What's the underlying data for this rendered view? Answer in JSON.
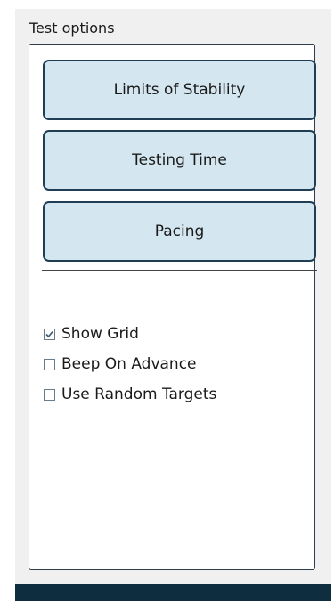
{
  "panel": {
    "title": "Test options"
  },
  "buttons": {
    "limits_of_stability": "Limits of Stability",
    "testing_time": "Testing Time",
    "pacing": "Pacing"
  },
  "options": {
    "show_grid": {
      "label": "Show Grid",
      "checked": true
    },
    "beep_on_advance": {
      "label": "Beep On Advance",
      "checked": false
    },
    "use_random_targets": {
      "label": "Use Random Targets",
      "checked": false
    }
  },
  "colors": {
    "button_fill": "#d4e6ef",
    "button_border": "#1f3e55",
    "bottom_bar": "#0e2d3f",
    "panel_background": "#f0f0f0"
  }
}
